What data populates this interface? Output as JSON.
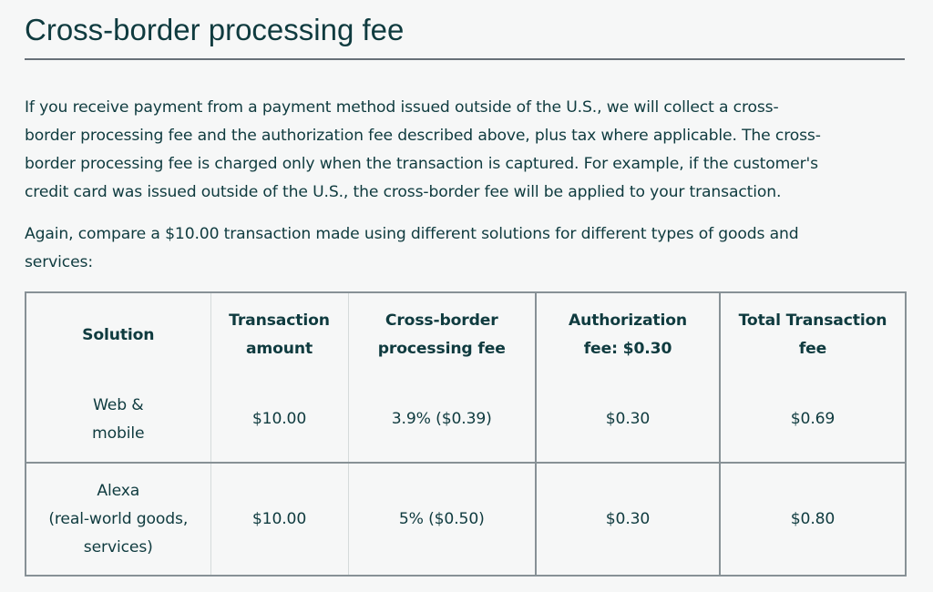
{
  "section": {
    "title": "Cross-border processing fee",
    "paragraph1_lines": [
      "If you receive payment from a payment method issued outside of the U.S., we will collect a cross-",
      "border processing fee and the authorization fee described above, plus tax where applicable. The cross-",
      "border processing fee is charged only when the transaction is captured. For example, if the customer's",
      "credit card was issued outside of the U.S., the cross-border fee will be applied to your transaction."
    ],
    "paragraph2_lines": [
      "Again, compare a $10.00 transaction made using different solutions for different types of goods and",
      "services:"
    ]
  },
  "table": {
    "headers": [
      {
        "line1": "Solution",
        "line2": ""
      },
      {
        "line1": "Transaction",
        "line2": "amount"
      },
      {
        "line1": "Cross-border",
        "line2": "processing fee"
      },
      {
        "line1": "Authorization",
        "line2": "fee: $0.30"
      },
      {
        "line1": "Total Transaction",
        "line2": "fee"
      }
    ],
    "rows": [
      {
        "solution_lines": [
          "Web &",
          "mobile"
        ],
        "transaction_amount": "$10.00",
        "cross_border_fee": "3.9% ($0.39)",
        "authorization_fee": "$0.30",
        "total_fee": "$0.69"
      },
      {
        "solution_lines": [
          "Alexa",
          "(real-world goods,",
          "services)"
        ],
        "transaction_amount": "$10.00",
        "cross_border_fee": "5% ($0.50)",
        "authorization_fee": "$0.30",
        "total_fee": "$0.80"
      }
    ]
  },
  "colors": {
    "text": "#0f3b3f",
    "background": "#f6f7f7",
    "rule": "#687078",
    "border_dark": "#879196",
    "border_light": "#d5dbdb"
  }
}
